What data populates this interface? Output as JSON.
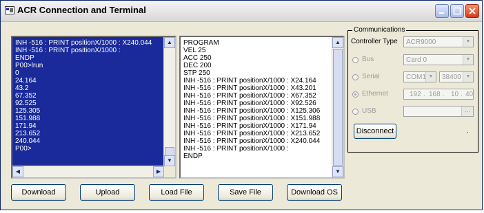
{
  "window": {
    "title": "ACR Connection and Terminal"
  },
  "terminal": {
    "lines": [
      "INH -516 : PRINT positionX/1000 : X240.044",
      "INH -516 : PRINT positionX/1000 :",
      "ENDP",
      "P00>lrun",
      "0",
      "24.164",
      "43.2",
      "67.352",
      "92.525",
      "125.305",
      "151.988",
      "171.94",
      "213.652",
      "240.044",
      "P00>"
    ]
  },
  "program": {
    "lines": [
      "PROGRAM",
      "VEL 25",
      "ACC 250",
      "DEC 200",
      "STP 250",
      "INH -516 : PRINT positionX/1000 : X24.164",
      "INH -516 : PRINT positionX/1000 : X43.201",
      "INH -516 : PRINT positionX/1000 : X67.352",
      "INH -516 : PRINT positionX/1000 : X92.526",
      "INH -516 : PRINT positionX/1000 : X125.306",
      "INH -516 : PRINT positionX/1000 : X151.988",
      "INH -516 : PRINT positionX/1000 : X171.94",
      "INH -516 : PRINT positionX/1000 : X213.652",
      "INH -516 : PRINT positionX/1000 : X240.044",
      "INH -516 : PRINT positionX/1000 :",
      "ENDP"
    ]
  },
  "communications": {
    "group_label": "Communications",
    "controller_type_label": "Controller Type",
    "controller_type_value": "ACR9000",
    "bus_label": "Bus",
    "bus_value": "Card 0",
    "serial_label": "Serial",
    "serial_port": "COM1",
    "serial_baud": "38400",
    "ethernet_label": "Ethernet",
    "ip": [
      "192",
      "168",
      "10",
      "40"
    ],
    "usb_label": "USB",
    "usb_button": "...",
    "disconnect_label": "Disconnect",
    "status_mark": "."
  },
  "buttons": {
    "download": "Download",
    "upload": "Upload",
    "load_file": "Load File",
    "save_file": "Save File",
    "download_os": "Download OS"
  },
  "colors": {
    "terminal_bg": "#1a2a9a",
    "title_accent": "#0a246a"
  },
  "icons": {
    "title": "app-icon",
    "minimize": "minimize-icon",
    "maximize": "maximize-icon",
    "close": "close-icon"
  }
}
